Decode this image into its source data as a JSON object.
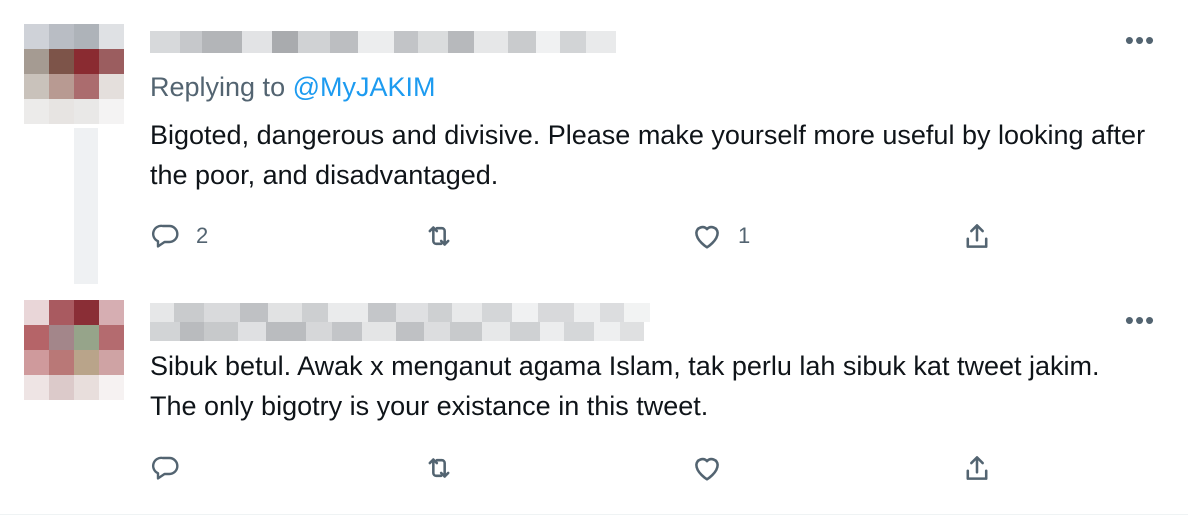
{
  "tweets": [
    {
      "replying_prefix": "Replying to ",
      "replying_handle": "@MyJAKIM",
      "text": "Bigoted, dangerous and divisive. Please make yourself more useful by looking after the poor, and disadvantaged.",
      "reply_count": "2",
      "retweet_count": "",
      "like_count": "1",
      "more_label": "•••",
      "icons": [
        "reply-icon",
        "retweet-icon",
        "heart-icon",
        "share-icon"
      ],
      "avatar_colors": [
        "#cfd2d8",
        "#b9bdc4",
        "#aeb3b9",
        "#dfe1e4",
        "#a59b92",
        "#7d5449",
        "#8a2b31",
        "#9b5d5f",
        "#c9c2bb",
        "#b89a92",
        "#ab6c6e",
        "#e4dfdc",
        "#ecebea",
        "#e7e4e2",
        "#e9e8e7",
        "#f4f3f3"
      ]
    },
    {
      "replying_prefix": "",
      "replying_handle": "",
      "text": "Sibuk betul. Awak x menganut agama Islam, tak perlu lah sibuk kat tweet jakim. The only bigotry is your existance in this tweet.",
      "reply_count": "",
      "retweet_count": "",
      "like_count": "",
      "more_label": "•••",
      "icons": [
        "reply-icon",
        "retweet-icon",
        "heart-icon",
        "share-icon"
      ],
      "avatar_colors": [
        "#e9d6d8",
        "#a95a60",
        "#8a2e36",
        "#d6aeb2",
        "#b56468",
        "#a3868a",
        "#96a48a",
        "#b46b6f",
        "#cf9a9c",
        "#b97877",
        "#b9a48a",
        "#cfa3a4",
        "#eee4e4",
        "#dccaca",
        "#e8dedc",
        "#f6f2f2"
      ]
    }
  ],
  "colors": {
    "accent_blue": "#1d9bf0",
    "secondary_text": "#536471",
    "primary_text": "#0f1419"
  }
}
